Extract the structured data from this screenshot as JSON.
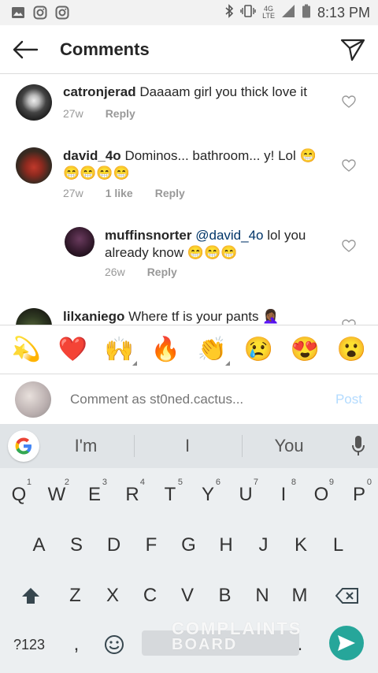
{
  "status_bar": {
    "time": "8:13 PM",
    "network": "4G",
    "network_sub": "LTE"
  },
  "header": {
    "title": "Comments"
  },
  "comments": [
    {
      "username": "catronjerad",
      "text": "Daaaam girl you thick love it",
      "age": "27w",
      "likes": "",
      "reply_label": "Reply"
    },
    {
      "username": "david_4o",
      "text": "Dominos... bathroom... y! Lol 😁😁😁😁😁",
      "age": "27w",
      "likes": "1 like",
      "reply_label": "Reply"
    },
    {
      "username": "muffinsnorter",
      "mention": "@david_4o",
      "text": "lol you already know 😁😁😁",
      "age": "26w",
      "likes": "",
      "reply_label": "Reply"
    },
    {
      "username": "lilxaniego",
      "text": "Where tf is your pants 🤦🏾‍♀️",
      "age": "",
      "likes": "",
      "reply_label": ""
    }
  ],
  "emoji_bar": [
    "💫",
    "❤️",
    "🙌",
    "🔥",
    "👏",
    "😢",
    "😍",
    "😮"
  ],
  "comment_input": {
    "placeholder": "Comment as st0ned.cactus...",
    "post_label": "Post"
  },
  "keyboard": {
    "suggestions": [
      "I'm",
      "I",
      "You"
    ],
    "row1": [
      {
        "k": "Q",
        "n": "1"
      },
      {
        "k": "W",
        "n": "2"
      },
      {
        "k": "E",
        "n": "3"
      },
      {
        "k": "R",
        "n": "4"
      },
      {
        "k": "T",
        "n": "5"
      },
      {
        "k": "Y",
        "n": "6"
      },
      {
        "k": "U",
        "n": "7"
      },
      {
        "k": "I",
        "n": "8"
      },
      {
        "k": "O",
        "n": "9"
      },
      {
        "k": "P",
        "n": "0"
      }
    ],
    "row2": [
      "A",
      "S",
      "D",
      "F",
      "G",
      "H",
      "J",
      "K",
      "L"
    ],
    "row3": [
      "Z",
      "X",
      "C",
      "V",
      "B",
      "N",
      "M"
    ],
    "symbols_label": "?123",
    "comma_label": ",",
    "period_label": "."
  },
  "watermark": {
    "line1": "COMPLAINTS",
    "line2": "BOARD"
  },
  "colors": {
    "accent_link": "#003569",
    "post_disabled": "#b3dbff",
    "enter_key": "#26a69a"
  }
}
